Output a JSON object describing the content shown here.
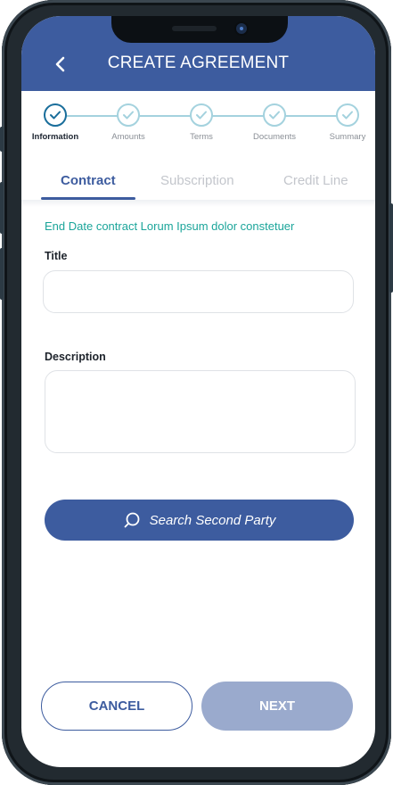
{
  "header": {
    "title": "CREATE AGREEMENT",
    "back_icon": "back-arrow-icon",
    "color": "#3d5c9f"
  },
  "stepper": {
    "steps": [
      {
        "label": "Information",
        "state": "active"
      },
      {
        "label": "Amounts",
        "state": "pending"
      },
      {
        "label": "Terms",
        "state": "pending"
      },
      {
        "label": "Documents",
        "state": "pending"
      },
      {
        "label": "Summary",
        "state": "pending"
      }
    ],
    "icon": "check-circle-icon"
  },
  "tabs": [
    {
      "label": "Contract",
      "selected": true
    },
    {
      "label": "Subscription",
      "selected": false
    },
    {
      "label": "Credit Line",
      "selected": false
    }
  ],
  "form": {
    "note": "End Date contract Lorum Ipsum dolor constetuer",
    "title_label": "Title",
    "title_value": "",
    "description_label": "Description",
    "description_value": "",
    "search_button": "Search Second Party",
    "search_icon": "search-icon"
  },
  "footer": {
    "cancel_label": "CANCEL",
    "next_label": "NEXT"
  },
  "colors": {
    "accent": "#3d5c9f",
    "teal": "#1ba59a",
    "step_line": "#a4d2de",
    "next_disabled": "#9aaacd"
  }
}
